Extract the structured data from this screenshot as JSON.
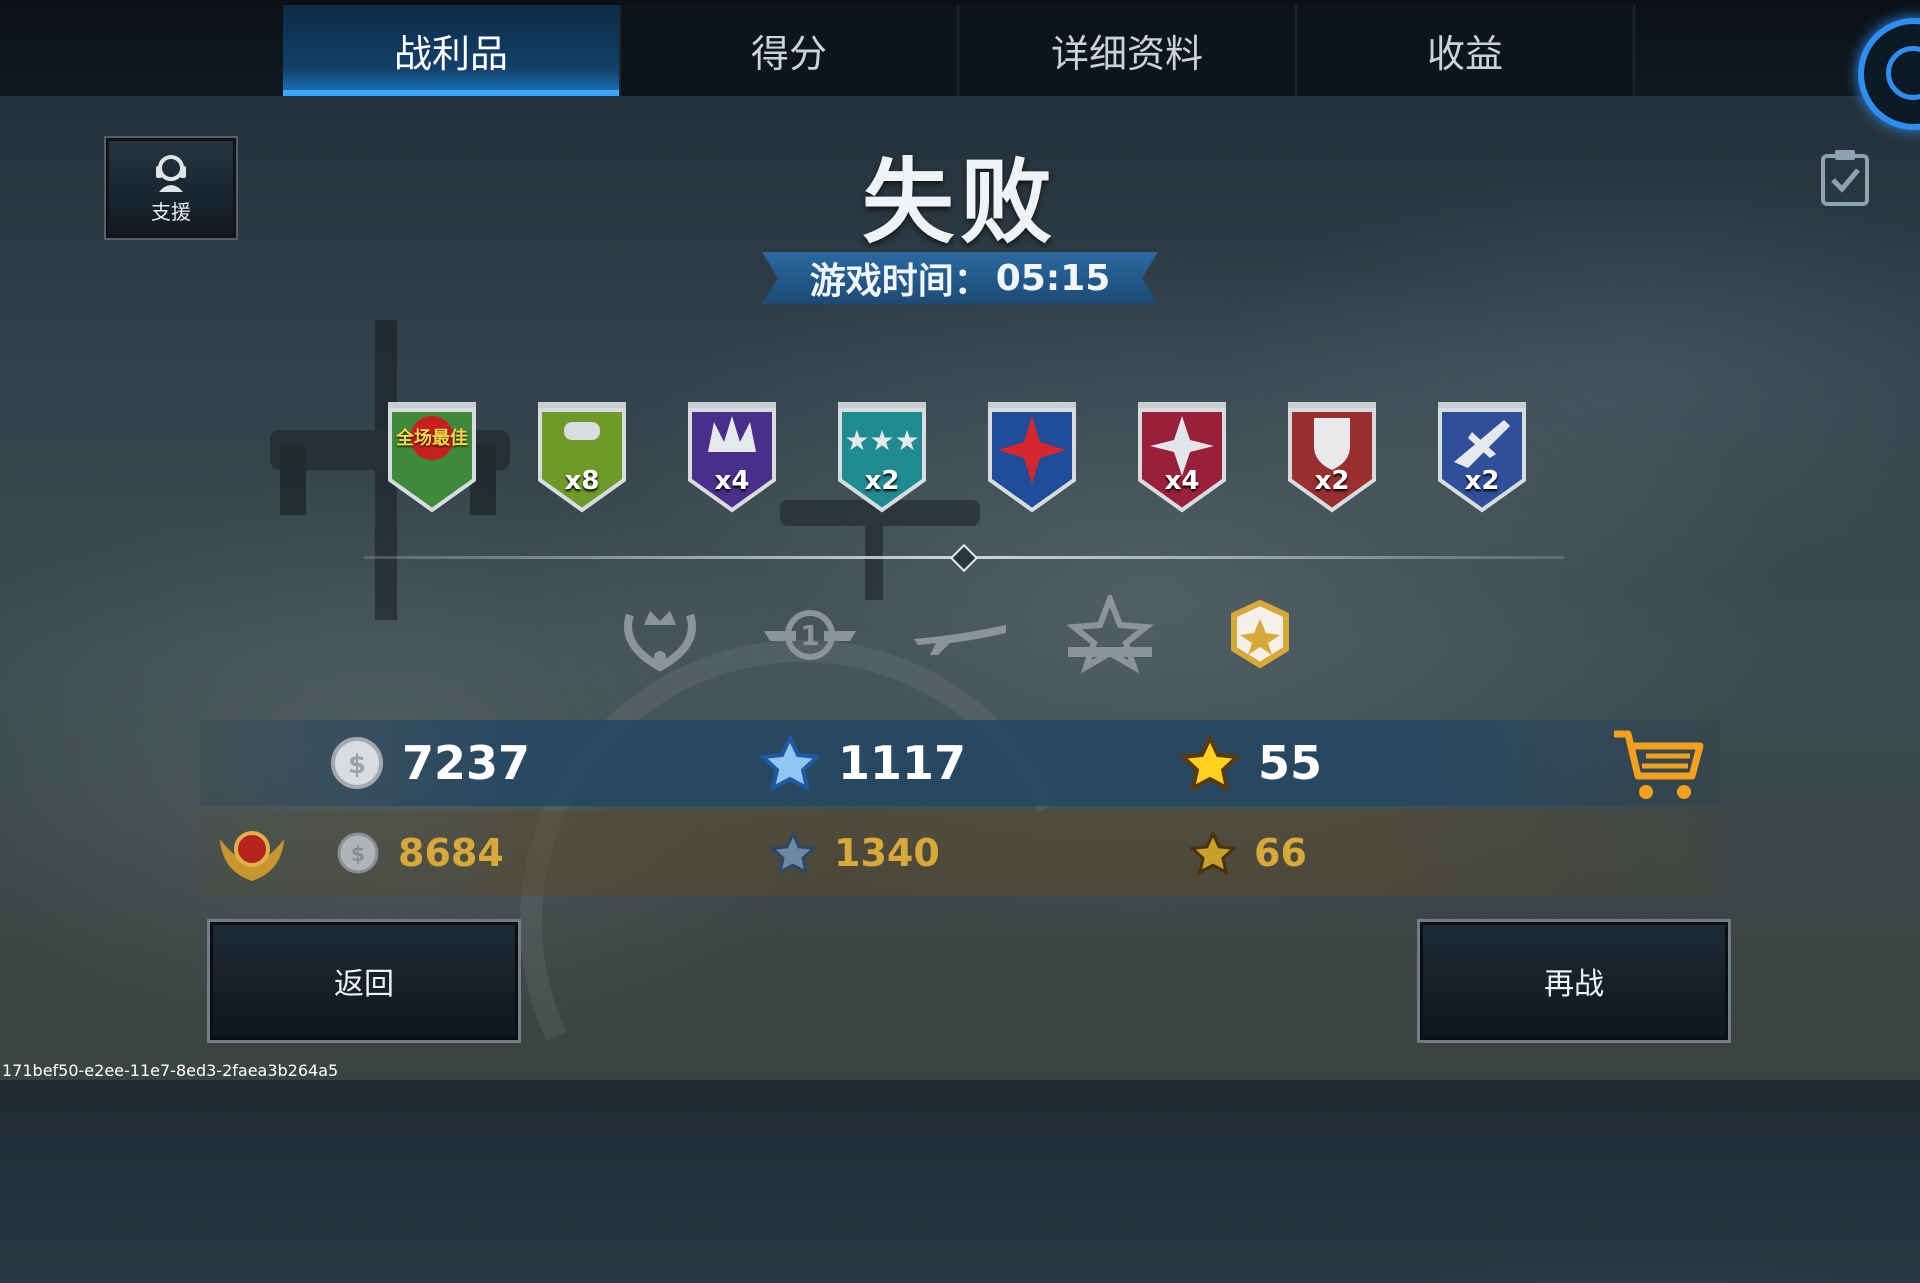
{
  "tabs": [
    {
      "label": "战利品",
      "active": true
    },
    {
      "label": "得分",
      "active": false
    },
    {
      "label": "详细资料",
      "active": false
    },
    {
      "label": "收益",
      "active": false
    }
  ],
  "support": {
    "label": "支援"
  },
  "result": {
    "title": "失败",
    "time_label": "游戏时间：",
    "time_value": "05:15"
  },
  "medals": [
    {
      "icon": "best-player-medal-icon",
      "text": "全场最佳",
      "multiplier": "",
      "color": "#3f8a3a"
    },
    {
      "icon": "bomb-medal-icon",
      "text": "",
      "multiplier": "x8",
      "color": "#6f9a2a"
    },
    {
      "icon": "explosion-medal-icon",
      "text": "",
      "multiplier": "x4",
      "color": "#4a2f8a"
    },
    {
      "icon": "stars-medal-icon",
      "text": "",
      "multiplier": "x2",
      "color": "#1f8a8f"
    },
    {
      "icon": "red-star-medal-icon",
      "text": "",
      "multiplier": "",
      "color": "#1f4d9a"
    },
    {
      "icon": "silver-star-medal-icon",
      "text": "",
      "multiplier": "x4",
      "color": "#9a1f3a"
    },
    {
      "icon": "shield-medal-icon",
      "text": "",
      "multiplier": "x2",
      "color": "#9a2f2f"
    },
    {
      "icon": "plane-medal-icon",
      "text": "",
      "multiplier": "x2",
      "color": "#2f4f9a"
    }
  ],
  "rank_icons": [
    "crown-wreath-icon",
    "winged-one-icon",
    "airplane-icon",
    "star-banner-icon",
    "gold-hexagon-icon"
  ],
  "stats": {
    "silver": "7237",
    "xp": "1117",
    "gold_stars": "55"
  },
  "premium_stats": {
    "silver": "8684",
    "xp": "1340",
    "gold_stars": "66"
  },
  "buttons": {
    "back": "返回",
    "retry": "再战"
  },
  "session_id": "171bef50-e2ee-11e7-8ed3-2faea3b264a5",
  "colors": {
    "accent_blue": "#1c79c4",
    "premium_gold": "#d6a93a"
  }
}
